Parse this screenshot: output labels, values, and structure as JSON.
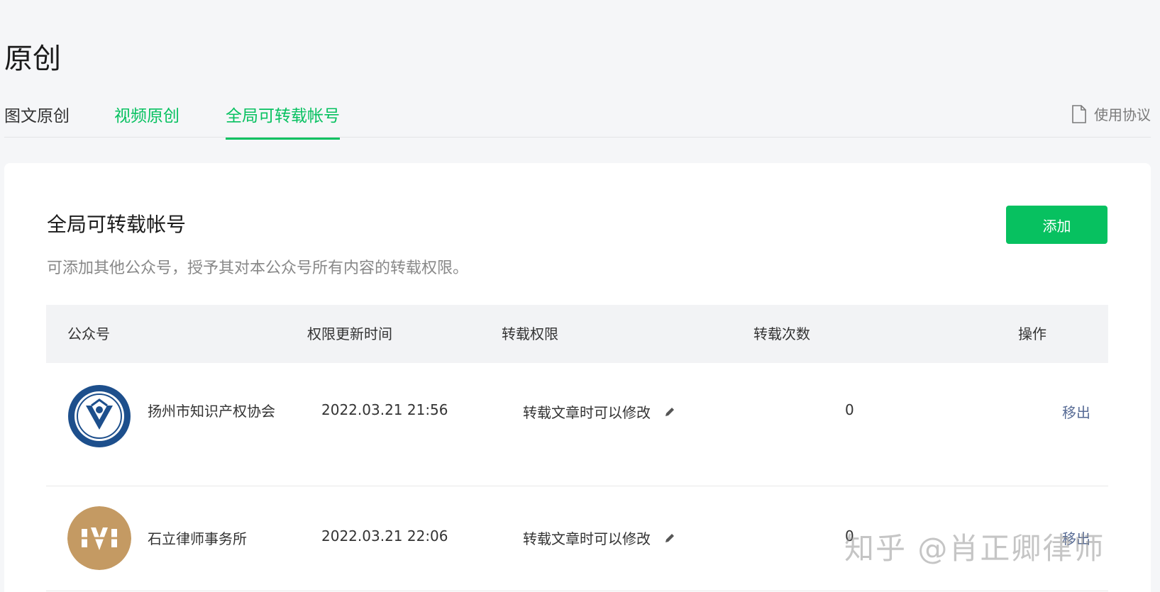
{
  "page": {
    "title": "原创"
  },
  "tabs": [
    {
      "label": "图文原创"
    },
    {
      "label": "视频原创"
    },
    {
      "label": "全局可转载帐号",
      "active": true
    }
  ],
  "agreement": {
    "label": "使用协议",
    "icon": "document-icon"
  },
  "section": {
    "title": "全局可转载帐号",
    "description": "可添加其他公众号，授予其对本公众号所有内容的转载权限。",
    "add_label": "添加"
  },
  "table": {
    "headers": [
      "公众号",
      "权限更新时间",
      "转载权限",
      "转载次数",
      "操作"
    ],
    "rows": [
      {
        "account": "扬州市知识产权协会",
        "time": "2022.03.21 21:56",
        "permission": "转载文章时可以修改",
        "count": "0",
        "action": "移出"
      },
      {
        "account": "石立律师事务所",
        "time": "2022.03.21 22:06",
        "permission": "转载文章时可以修改",
        "count": "0",
        "action": "移出"
      }
    ]
  },
  "watermark": "知乎 @肖正卿律师",
  "colors": {
    "accent": "#07c160",
    "link": "#576b95"
  }
}
